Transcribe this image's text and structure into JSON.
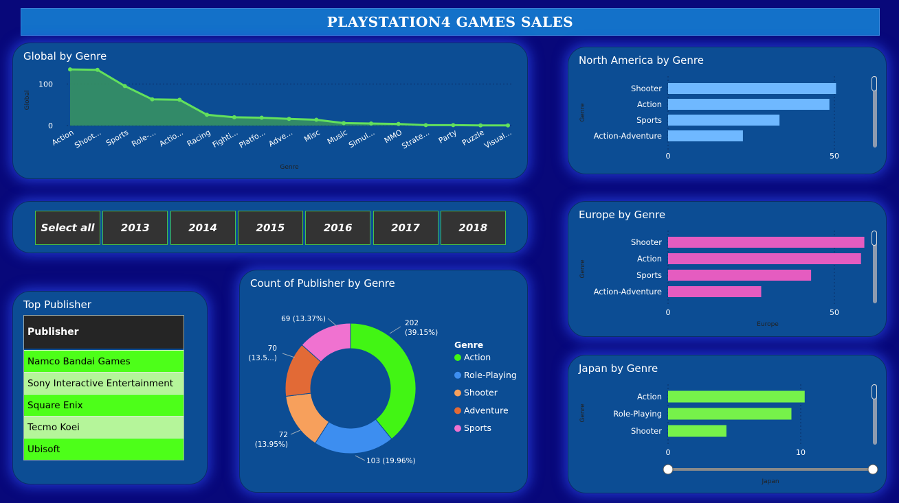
{
  "header": {
    "title": "PLAYSTATION4 GAMES SALES"
  },
  "global_card": {
    "title": "Global by Genre",
    "chart_data": {
      "type": "area",
      "categories": [
        "Action",
        "Shoot...",
        "Sports",
        "Role-...",
        "Actio...",
        "Racing",
        "Fighti...",
        "Platfo...",
        "Adve...",
        "Misc",
        "Music",
        "Simul...",
        "MMO",
        "Strate...",
        "Party",
        "Puzzle",
        "Visual..."
      ],
      "values": [
        135,
        134,
        95,
        63,
        62,
        26,
        20,
        19,
        16,
        14,
        6,
        5,
        4,
        1,
        1,
        0.5,
        0.5
      ],
      "yticks": [
        "0",
        "100"
      ],
      "ylim": [
        0,
        150
      ],
      "xlabel": "Genre",
      "ylabel": "Global",
      "color": "#63e05c"
    }
  },
  "slicer": {
    "items": [
      "Select all",
      "2013",
      "2014",
      "2015",
      "2016",
      "2017",
      "2018"
    ]
  },
  "publisher_card": {
    "title": "Top Publisher",
    "column_header": "Publisher",
    "rows": [
      "Namco Bandai Games",
      "Sony Interactive Entertainment",
      "Square Enix",
      "Tecmo Koei",
      "Ubisoft"
    ]
  },
  "donut_card": {
    "title": "Count of Publisher by Genre",
    "legend_title": "Genre",
    "chart_data": {
      "type": "pie",
      "labels": [
        "Action",
        "Role-Playing",
        "Shooter",
        "Adventure",
        "Sports"
      ],
      "values": [
        202,
        103,
        72,
        70,
        69
      ],
      "data_labels": [
        "202 (39.15%)",
        "103 (19.96%)",
        "72 (13.95%)",
        "70 (13.5...)",
        "69 (13.37%)"
      ],
      "colors": [
        "#42f514",
        "#3d8ef0",
        "#f7a05c",
        "#e26a36",
        "#f072d0"
      ]
    }
  },
  "na_card": {
    "title": "North America by Genre",
    "chart_data": {
      "type": "bar",
      "categories": [
        "Shooter",
        "Action",
        "Sports",
        "Action-Adventure"
      ],
      "values": [
        50.5,
        48.5,
        33.5,
        22.5
      ],
      "xlim": [
        0,
        60
      ],
      "xticks": [
        "0",
        "50"
      ],
      "ylabel": "Genre",
      "color": "#6fb8ff"
    }
  },
  "eu_card": {
    "title": "Europe by Genre",
    "chart_data": {
      "type": "bar",
      "categories": [
        "Shooter",
        "Action",
        "Sports",
        "Action-Adventure"
      ],
      "values": [
        59,
        58,
        43,
        28
      ],
      "xlim": [
        0,
        60
      ],
      "xticks": [
        "0",
        "50"
      ],
      "xlabel": "Europe",
      "ylabel": "Genre",
      "color": "#e55cc0"
    }
  },
  "jp_card": {
    "title": "Japan by Genre",
    "chart_data": {
      "type": "bar",
      "categories": [
        "Action",
        "Role-Playing",
        "Shooter"
      ],
      "values": [
        10.3,
        9.3,
        4.4
      ],
      "xlim": [
        0,
        16
      ],
      "xticks": [
        "0",
        "10"
      ],
      "xlabel": "Japan",
      "ylabel": "Genre",
      "color": "#76f24a"
    }
  }
}
